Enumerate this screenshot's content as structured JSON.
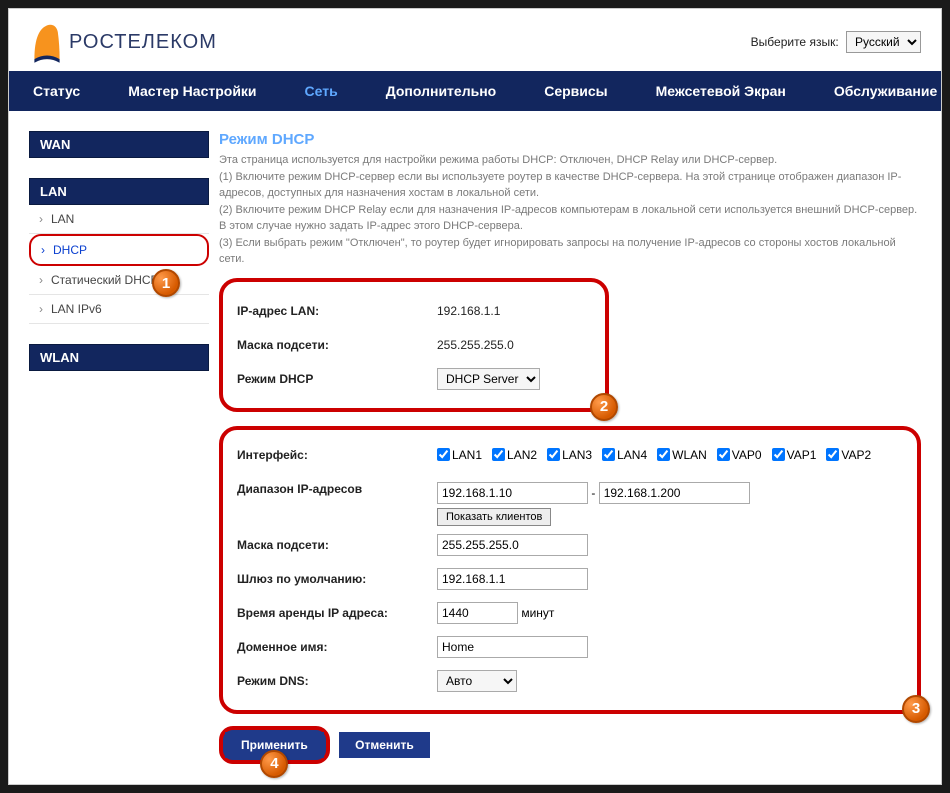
{
  "lang": {
    "label": "Выберите язык:",
    "value": "Русский"
  },
  "brand": "РОСТЕЛЕКОМ",
  "nav": [
    "Статус",
    "Мастер Настройки",
    "Сеть",
    "Дополнительно",
    "Сервисы",
    "Межсетевой Экран",
    "Обслуживание"
  ],
  "nav_active": 2,
  "sidebar": {
    "groups": [
      {
        "head": "WAN",
        "items": []
      },
      {
        "head": "LAN",
        "items": [
          "LAN",
          "DHCP",
          "Статический DHCP",
          "LAN IPv6"
        ],
        "active": 1
      },
      {
        "head": "WLAN",
        "items": []
      }
    ]
  },
  "title": "Режим DHCP",
  "desc_lines": [
    "Эта страница используется для настройки режима работы DHCP: Отключен, DHCP Relay или DHCP-сервер.",
    "(1) Включите режим DHCP-сервер если вы используете роутер в качестве DHCP-сервера. На этой странице отображен диапазон IP-адресов, доступных для назначения хостам в локальной сети.",
    "(2) Включите режим DHCP Relay если для назначения IP-адресов компьютерам в локальной сети используется внешний DHCP-сервер. В этом случае нужно задать IP-адрес этого DHCP-сервера.",
    "(3) Если выбрать режим \"Отключен\", то роутер будет игнорировать запросы на получение IP-адресов со стороны хостов локальной сети."
  ],
  "card1": {
    "ip_lan_label": "IP-адрес LAN:",
    "ip_lan": "192.168.1.1",
    "mask_label": "Маска подсети:",
    "mask": "255.255.255.0",
    "mode_label": "Режим DHCP",
    "mode_value": "DHCP Server"
  },
  "card2": {
    "iface_label": "Интерфейс:",
    "ifaces": [
      "LAN1",
      "LAN2",
      "LAN3",
      "LAN4",
      "WLAN",
      "VAP0",
      "VAP1",
      "VAP2"
    ],
    "range_label": "Диапазон IP-адресов",
    "range_from": "192.168.1.10",
    "range_to": "192.168.1.200",
    "show_clients": "Показать клиентов",
    "mask_label": "Маска подсети:",
    "mask": "255.255.255.0",
    "gw_label": "Шлюз по умолчанию:",
    "gw": "192.168.1.1",
    "lease_label": "Время аренды IP адреса:",
    "lease": "1440",
    "lease_unit": "минут",
    "domain_label": "Доменное имя:",
    "domain": "Home",
    "dns_label": "Режим DNS:",
    "dns_value": "Авто"
  },
  "buttons": {
    "apply": "Применить",
    "cancel": "Отменить"
  },
  "badges": {
    "b1": "1",
    "b2": "2",
    "b3": "3",
    "b4": "4"
  }
}
